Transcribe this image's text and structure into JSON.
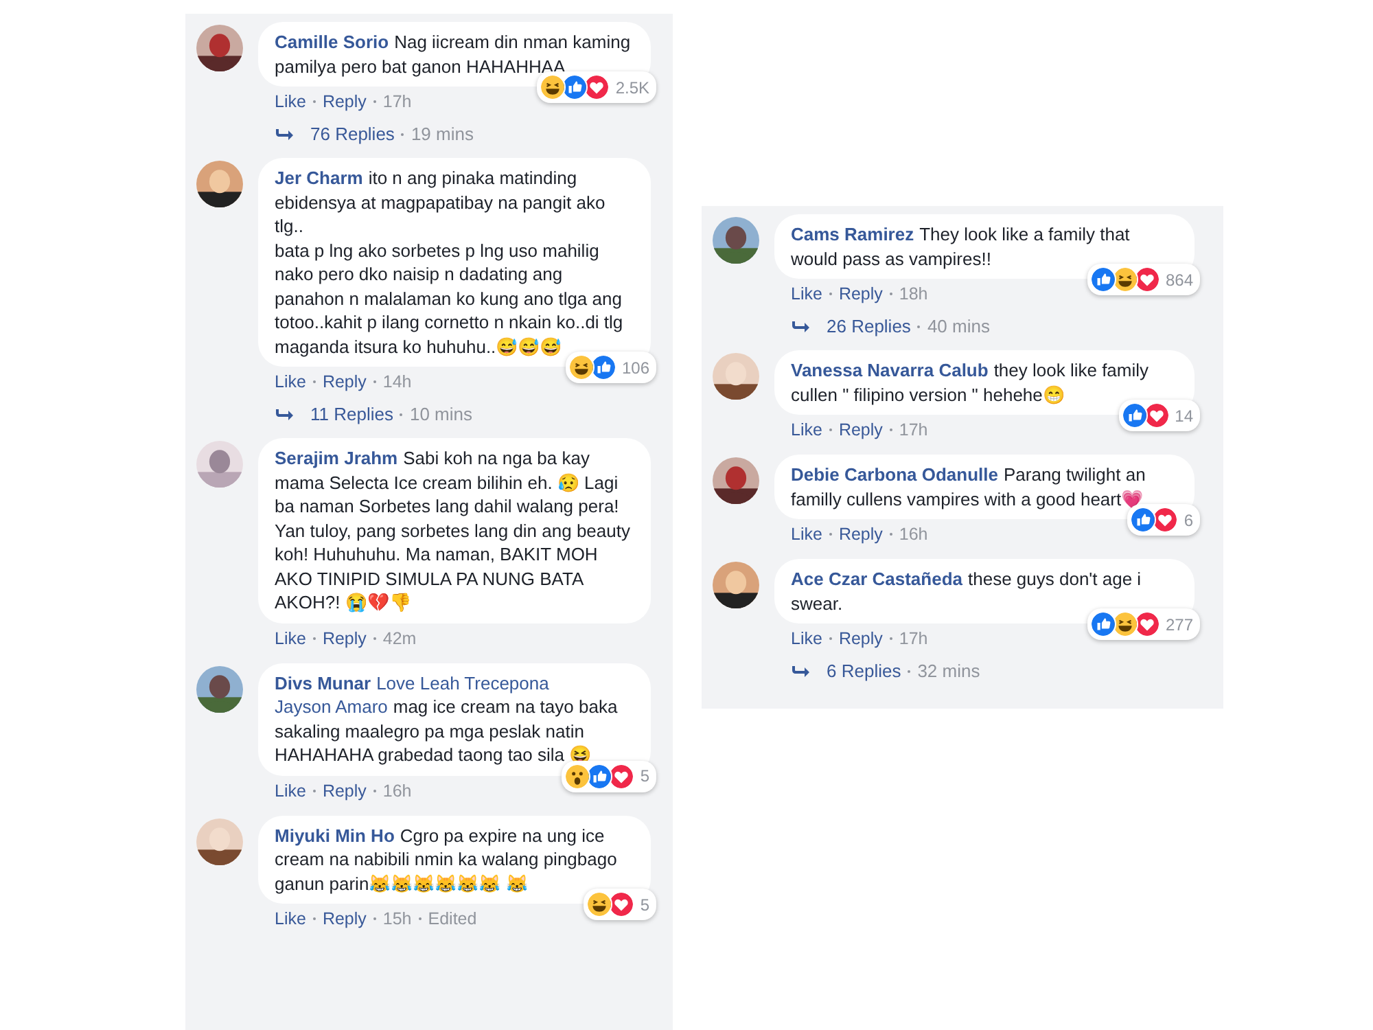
{
  "panels": [
    {
      "comments": [
        {
          "author": "Camille Sorio",
          "text": "Nag iicream din nman kaming pamilya pero bat ganon HAHAHHAA",
          "reactions": [
            {
              "kind": "haha"
            },
            {
              "kind": "like"
            },
            {
              "kind": "love"
            }
          ],
          "reaction_count": "2.5K",
          "actions": [
            "Like",
            "Reply",
            "17h"
          ],
          "replies": {
            "label": "76 Replies",
            "time": "19 mins"
          }
        },
        {
          "author": "Jer Charm",
          "text": "ito n ang pinaka matinding ebidensya at magpapatibay na pangit ako tlg..\nbata p lng ako sorbetes p lng uso mahilig nako pero dko naisip n dadating ang panahon n malalaman ko kung ano tlga ang totoo..kahit p ilang cornetto n nkain ko..di tlg maganda itsura ko huhuhu..😅😅😅",
          "reactions": [
            {
              "kind": "haha"
            },
            {
              "kind": "like"
            }
          ],
          "reaction_count": "106",
          "actions": [
            "Like",
            "Reply",
            "14h"
          ],
          "replies": {
            "label": "11 Replies",
            "time": "10 mins"
          }
        },
        {
          "author": "Serajim Jrahm",
          "text": "Sabi koh na nga ba kay mama Selecta Ice cream bilihin eh. 😥 Lagi ba naman Sorbetes lang dahil walang pera! Yan tuloy, pang sorbetes lang din ang beauty koh! Huhuhuhu. Ma naman, BAKIT MOH AKO TINIPID SIMULA PA NUNG BATA AKOH?! 😭💔👎",
          "actions": [
            "Like",
            "Reply",
            "42m"
          ]
        },
        {
          "author": "Divs Munar",
          "mentions": [
            "Love Leah Trecepona",
            "Jayson Amaro"
          ],
          "text": "mag ice cream na tayo baka sakaling maalegro pa mga peslak natin HAHAHAHA grabedad taong tao sila 😆",
          "reactions": [
            {
              "kind": "wow"
            },
            {
              "kind": "like"
            },
            {
              "kind": "love"
            }
          ],
          "reaction_count": "5",
          "actions": [
            "Like",
            "Reply",
            "16h"
          ]
        },
        {
          "author": "Miyuki Min Ho",
          "text": "Cgro pa expire na ung ice cream na nabibili nmin ka walang pingbago ganun parin😹😹😹😹😹😹 😹",
          "reactions": [
            {
              "kind": "haha"
            },
            {
              "kind": "love"
            }
          ],
          "reaction_count": "5",
          "actions": [
            "Like",
            "Reply",
            "15h",
            "Edited"
          ]
        }
      ]
    },
    {
      "comments": [
        {
          "author": "Cams Ramirez",
          "text": "They look like a family that would pass as vampires!!",
          "reactions": [
            {
              "kind": "like"
            },
            {
              "kind": "haha"
            },
            {
              "kind": "love"
            }
          ],
          "reaction_count": "864",
          "actions": [
            "Like",
            "Reply",
            "18h"
          ],
          "replies": {
            "label": "26 Replies",
            "time": "40 mins"
          }
        },
        {
          "author": "Vanessa Navarra Calub",
          "text": "they look like family cullen \" filipino version \" hehehe😁",
          "reactions": [
            {
              "kind": "like"
            },
            {
              "kind": "love"
            }
          ],
          "reaction_count": "14",
          "actions": [
            "Like",
            "Reply",
            "17h"
          ]
        },
        {
          "author": "Debie Carbona Odanulle",
          "text": "Parang twilight an familly cullens vampires with a good heart💗",
          "reactions": [
            {
              "kind": "like"
            },
            {
              "kind": "love"
            }
          ],
          "reaction_count": "6",
          "actions": [
            "Like",
            "Reply",
            "16h"
          ]
        },
        {
          "author": "Ace Czar Castañeda",
          "text": "these guys don't age i swear.",
          "reactions": [
            {
              "kind": "like"
            },
            {
              "kind": "haha"
            },
            {
              "kind": "love"
            }
          ],
          "reaction_count": "277",
          "actions": [
            "Like",
            "Reply",
            "17h"
          ],
          "replies": {
            "label": "6 Replies",
            "time": "32 mins"
          }
        }
      ]
    }
  ]
}
